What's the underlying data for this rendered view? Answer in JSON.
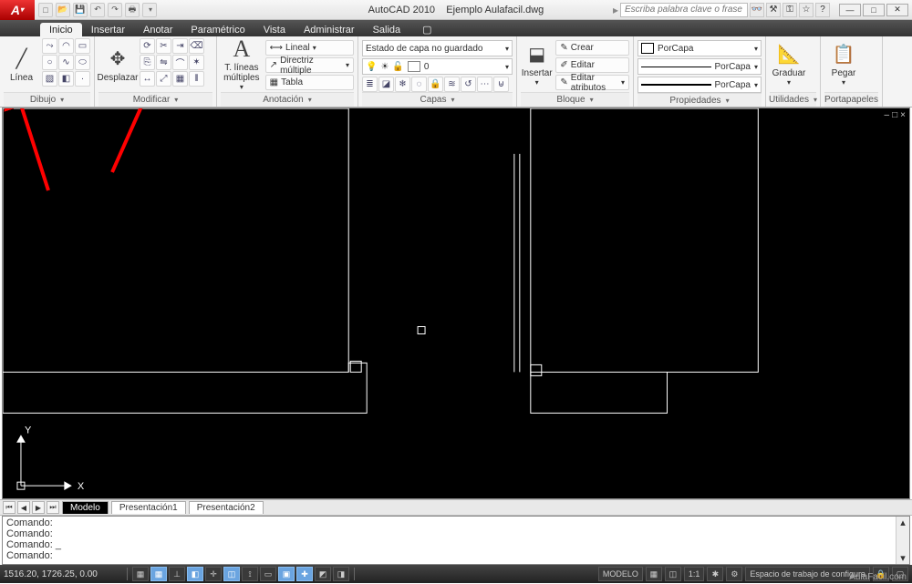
{
  "title": {
    "app": "AutoCAD 2010",
    "file": "Ejemplo Aulafacil.dwg"
  },
  "qat_icons": [
    "new",
    "open",
    "save",
    "undo",
    "redo",
    "print"
  ],
  "search": {
    "placeholder": "Escriba palabra clave o frase"
  },
  "search_icons": [
    "binoculars",
    "wrench",
    "key",
    "star",
    "help"
  ],
  "window_buttons": [
    "min",
    "max",
    "close"
  ],
  "tabs": [
    "Inicio",
    "Insertar",
    "Anotar",
    "Paramétrico",
    "Vista",
    "Administrar",
    "Salida"
  ],
  "active_tab": 0,
  "ribbon": {
    "dibujo": {
      "label": "Dibujo",
      "big": {
        "label": "Línea"
      },
      "icons": [
        "line",
        "polyline",
        "circle",
        "arc",
        "rect",
        "ellipse",
        "hatch",
        "spline",
        "point"
      ]
    },
    "modificar": {
      "label": "Modificar",
      "big": {
        "label": "Desplazar"
      },
      "icons": [
        "rotate",
        "trim",
        "extend",
        "copy",
        "mirror",
        "fillet",
        "stretch",
        "scale",
        "array",
        "erase",
        "explode",
        "offset"
      ]
    },
    "anotacion": {
      "label": "Anotación",
      "big": {
        "label1": "T. líneas",
        "label2": "múltiples"
      },
      "items": {
        "lineal": "Lineal",
        "directriz": "Directriz múltiple",
        "tabla": "Tabla"
      }
    },
    "capas": {
      "label": "Capas",
      "combo": "Estado de capa no guardado",
      "layer_current": "0",
      "icons": [
        "layeriso",
        "layerfrz",
        "layeroff",
        "layerlock",
        "layermatch",
        "layerprev",
        "layerstate",
        "layerwalk",
        "layermrg"
      ]
    },
    "bloque": {
      "label": "Bloque",
      "big": {
        "label": "Insertar"
      },
      "items": {
        "crear": "Crear",
        "editar": "Editar",
        "atributos": "Editar atributos"
      }
    },
    "propiedades": {
      "label": "Propiedades",
      "combo_color": "PorCapa",
      "combo_line": "PorCapa",
      "combo_lw": "PorCapa"
    },
    "utilidades": {
      "label": "Utilidades",
      "big": {
        "label": "Graduar"
      }
    },
    "portapapeles": {
      "label": "Portapapeles",
      "big": {
        "label": "Pegar"
      }
    }
  },
  "canvas": {
    "cursor_marker": true,
    "ucs": {
      "x": "X",
      "y": "Y"
    },
    "mini_win": [
      "–",
      "□",
      "×"
    ]
  },
  "sheets": {
    "nav": [
      "⏮",
      "◀",
      "▶",
      "⏭"
    ],
    "tabs": [
      "Modelo",
      "Presentación1",
      "Presentación2"
    ],
    "active": 0
  },
  "command": {
    "prompt": "Comando:",
    "lines": 4
  },
  "status": {
    "coords": "1516.20, 1726.25, 0.00",
    "toggles": [
      {
        "glyph": "▦",
        "on": false
      },
      {
        "glyph": "▦",
        "on": true
      },
      {
        "glyph": "⊥",
        "on": false
      },
      {
        "glyph": "◧",
        "on": true
      },
      {
        "glyph": "✛",
        "on": false
      },
      {
        "glyph": "◫",
        "on": true
      },
      {
        "glyph": "⟟",
        "on": false
      },
      {
        "glyph": "▭",
        "on": false
      },
      {
        "glyph": "▣",
        "on": true
      },
      {
        "glyph": "✚",
        "on": true
      },
      {
        "glyph": "◩",
        "on": false
      },
      {
        "glyph": "◨",
        "on": false
      }
    ],
    "right": {
      "model": "MODELO",
      "workspace": "Espacio de trabajo de configura",
      "scale": "1:1"
    }
  },
  "watermark": "AulaFacil.com"
}
